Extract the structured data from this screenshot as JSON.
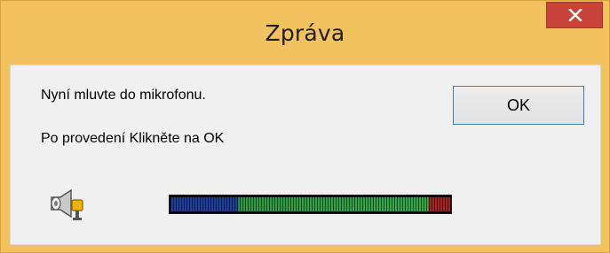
{
  "window": {
    "title": "Zpráva",
    "close_icon": "close-icon"
  },
  "message": {
    "line1": "Nyní mluvte do mikrofonu.",
    "line2": "Po provedení Klikněte na OK"
  },
  "buttons": {
    "ok_label": "OK"
  },
  "icons": {
    "speaker": "megaphone-microphone-icon"
  },
  "meter": {
    "level_fraction": 1.0,
    "colors": {
      "low": "#1f3f9b",
      "mid": "#35a84a",
      "high": "#a4241f"
    }
  },
  "colors": {
    "titlebar": "#f2c25f",
    "close_button": "#c8443b",
    "client": "#f0f0f0",
    "ok_border": "#3c7fb1"
  }
}
